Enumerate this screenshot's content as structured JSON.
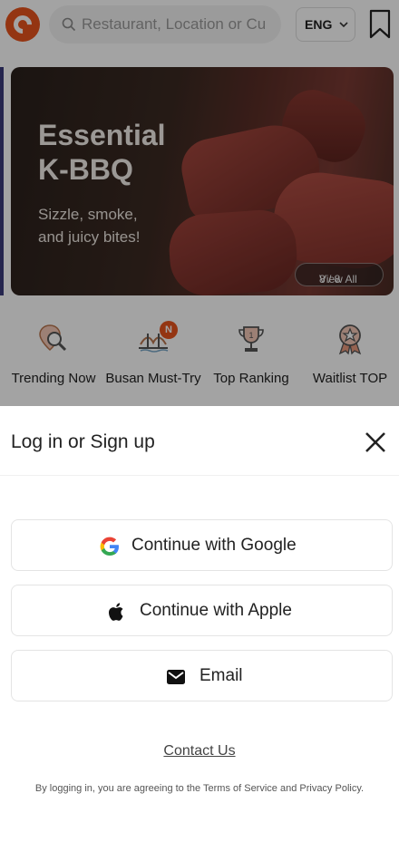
{
  "header": {
    "search_placeholder": "Restaurant, Location or Cu",
    "language": "ENG"
  },
  "banner": {
    "title_line1": "Essential",
    "title_line2": "K-BBQ",
    "subtitle_line1": "Sizzle, smoke,",
    "subtitle_line2": "and juicy bites!",
    "pager": "8 / 8",
    "view_all": "View All"
  },
  "categories": [
    {
      "label": "Trending Now",
      "icon": "magnifier-pin-icon"
    },
    {
      "label": "Busan Must-Try",
      "icon": "bridge-icon",
      "badge": "N"
    },
    {
      "label": "Top Ranking",
      "icon": "trophy-icon"
    },
    {
      "label": "Waitlist TOP",
      "icon": "medal-icon"
    }
  ],
  "sheet": {
    "title": "Log in or Sign up",
    "google_label": "Continue with Google",
    "apple_label": "Continue with Apple",
    "email_label": "Email",
    "contact": "Contact Us",
    "terms": "By logging in, you are agreeing to the Terms of Service and Privacy Policy."
  },
  "colors": {
    "brand": "#e8531d",
    "overlay": "rgba(0,0,0,0.36)"
  }
}
